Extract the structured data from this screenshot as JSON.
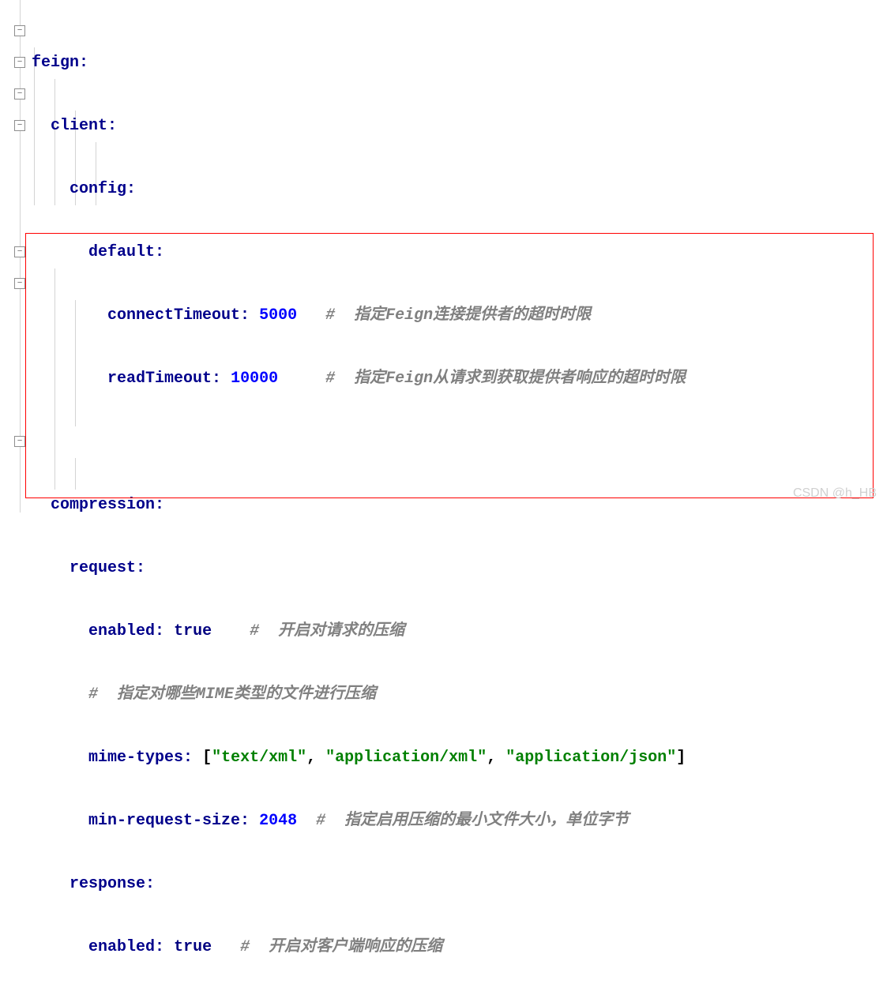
{
  "code": {
    "l1_key": "feign",
    "l2_key": "client",
    "l3_key": "config",
    "l4_key": "default",
    "l5_key": "connectTimeout",
    "l5_val": "5000",
    "l5_comment": "#  指定Feign连接提供者的超时时限",
    "l6_key": "readTimeout",
    "l6_val": "10000",
    "l6_comment": "#  指定Feign从请求到获取提供者响应的超时时限",
    "l8_key": "compression",
    "l9_key": "request",
    "l10_key": "enabled",
    "l10_val": "true",
    "l10_comment": "#  开启对请求的压缩",
    "l11_comment": "#  指定对哪些MIME类型的文件进行压缩",
    "l12_key": "mime-types",
    "l12_s1": "\"text/xml\"",
    "l12_s2": "\"application/xml\"",
    "l12_s3": "\"application/json\"",
    "l13_key": "min-request-size",
    "l13_val": "2048",
    "l13_comment": "#  指定启用压缩的最小文件大小，单位字节",
    "l14_key": "response",
    "l15_key": "enabled",
    "l15_val": "true",
    "l15_comment": "#  开启对客户端响应的压缩"
  },
  "watermark": "CSDN @h_HB"
}
